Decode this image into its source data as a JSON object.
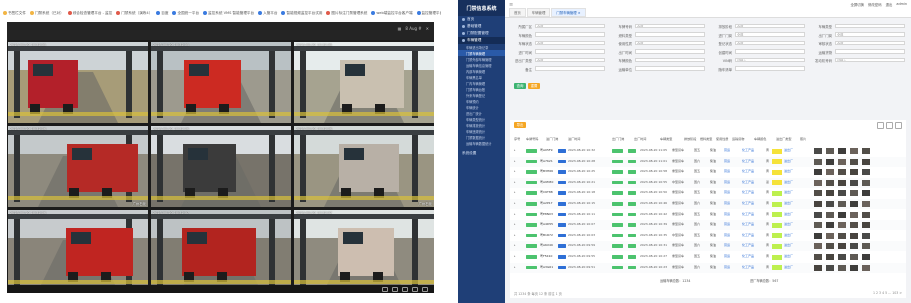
{
  "left": {
    "bookmarks": [
      {
        "label": "书签栏文件",
        "color": "#f2b544"
      },
      {
        "label": "门禁系统（已对）",
        "color": "#f2b544"
      },
      {
        "label": "综合检查管理平台 - 监控",
        "color": "#e05a4a"
      },
      {
        "label": "门禁系统（演练4）",
        "color": "#e05a4a"
      },
      {
        "label": "百度",
        "color": "#3a7be0"
      },
      {
        "label": "全国统一平台",
        "color": "#3a7be0"
      },
      {
        "label": "监控系统 VMS 智能管理平台",
        "color": "#3a7be0"
      },
      {
        "label": "入管平台",
        "color": "#3a7be0"
      },
      {
        "label": "智能视频监控平台试用",
        "color": "#3a7be0"
      },
      {
        "label": "图片标注门禁管理系统",
        "color": "#e05a4a"
      },
      {
        "label": "web端监控平台客户端",
        "color": "#3a7be0"
      },
      {
        "label": "监控管理平台",
        "color": "#3a7be0"
      }
    ],
    "toolbar_text": "8 Aug #",
    "bottom_text": "",
    "cams": [
      {
        "ts": "2023-08-20 10:32:05",
        "label": ""
      },
      {
        "ts": "2023-08-20 10:32:05",
        "label": ""
      },
      {
        "ts": "2023-08-20 10:32:05",
        "label": ""
      },
      {
        "ts": "2023-08-20 10:32:06",
        "label": "广州石化"
      },
      {
        "ts": "2023-08-20 10:32:06",
        "label": ""
      },
      {
        "ts": "2023-08-20 10:32:06",
        "label": "广州石化"
      },
      {
        "ts": "2023-08-20 10:32:06",
        "label": ""
      },
      {
        "ts": "2023-08-20 10:32:07",
        "label": "环保门禁系统-高清"
      },
      {
        "ts": "2023-08-20 10:32:07",
        "label": "进场道路-监控"
      }
    ]
  },
  "right": {
    "logo": "门禁信息系统",
    "header_right": [
      "全屏切换",
      "修改密码",
      "退出"
    ],
    "user": "admin",
    "tabs": [
      "首页",
      "车辆管理",
      "门禁车辆管理 ×"
    ],
    "menu": [
      {
        "label": "首页",
        "active": false
      },
      {
        "label": "基础管理",
        "active": false
      },
      {
        "label": "门禁配置管理",
        "active": false
      },
      {
        "label": "车辆管理",
        "active": true
      }
    ],
    "submenu": [
      "车辆进出场记录",
      "门禁车辆管理",
      "门禁外部车辆管理",
      "运输车辆信息管理",
      "内部车辆管理",
      "车辆黑名单",
      "厂内车辆管理",
      "门禁车辆台账",
      "外来车辆登记",
      "车辆预约",
      "车辆统计",
      "进出厂统计",
      "车辆类型统计",
      "车辆排放统计",
      "车辆违规统计",
      "门禁数据统计",
      "运输车辆数据统计"
    ],
    "menu_bottom": "系统设置",
    "filters": [
      {
        "label": "所属厂区",
        "value": "全部"
      },
      {
        "label": "车牌号码",
        "value": "全部"
      },
      {
        "label": "排放阶段",
        "value": "全部"
      },
      {
        "label": "车辆类型",
        "value": ""
      },
      {
        "label": "车辆颜色",
        "value": ""
      },
      {
        "label": "燃料类型",
        "value": ""
      },
      {
        "label": "进厂门岗",
        "value": "全部"
      },
      {
        "label": "出厂门岗",
        "value": "全部"
      },
      {
        "label": "车辆状态",
        "value": "全部"
      },
      {
        "label": "使用性质",
        "value": "全部"
      },
      {
        "label": "登记状态",
        "value": "全部"
      },
      {
        "label": "审核状态",
        "value": "全部"
      },
      {
        "label": "进厂时间",
        "value": ""
      },
      {
        "label": "出厂时间",
        "value": ""
      },
      {
        "label": "创建时间",
        "value": ""
      },
      {
        "label": "运输货物",
        "value": ""
      },
      {
        "label": "进出厂类型",
        "value": "全部"
      },
      {
        "label": "车牌颜色",
        "value": ""
      },
      {
        "label": "VIN码",
        "value": "请输入"
      },
      {
        "label": "发动机号码",
        "value": "请输入"
      },
      {
        "label": "备注",
        "value": ""
      },
      {
        "label": "运输单位",
        "value": ""
      },
      {
        "label": "随车清单",
        "value": ""
      }
    ],
    "btn_search": "查询",
    "btn_reset": "重置",
    "btn_export": "导出",
    "columns": [
      "序号",
      "车牌号码",
      "进厂门岗",
      "进厂时间",
      "出厂门岗",
      "出厂时间",
      "车辆类型",
      "排放阶段",
      "燃料类型",
      "使用性质",
      "运输货物",
      "车辆颜色",
      "进出厂类型",
      "照片"
    ],
    "rows": [
      {
        "plate": "粤A05F9",
        "tm1": "2023-08-20 10:32",
        "tm2": "2023-08-20 11:05",
        "type": "重型货车",
        "em": "国五",
        "fuel": "柴油",
        "col": "黄"
      },
      {
        "plate": "粤A7K21",
        "tm1": "2023-08-20 10:28",
        "tm2": "2023-08-20 11:01",
        "type": "重型货车",
        "em": "国六",
        "fuel": "柴油",
        "col": "黄"
      },
      {
        "plate": "粤B3H66",
        "tm1": "2023-08-20 10:25",
        "tm2": "2023-08-20 10:58",
        "type": "重型货车",
        "em": "国五",
        "fuel": "柴油",
        "col": "黄"
      },
      {
        "plate": "粤A9M30",
        "tm1": "2023-08-20 10:21",
        "tm2": "2023-08-20 10:55",
        "type": "中型货车",
        "em": "国六",
        "fuel": "柴油",
        "col": "蓝"
      },
      {
        "plate": "粤C6T88",
        "tm1": "2023-08-20 10:18",
        "tm2": "2023-08-20 10:50",
        "type": "重型货车",
        "em": "国五",
        "fuel": "柴油",
        "col": "黄"
      },
      {
        "plate": "粤A2P17",
        "tm1": "2023-08-20 10:15",
        "tm2": "2023-08-20 10:46",
        "type": "重型货车",
        "em": "国六",
        "fuel": "柴油",
        "col": "黄"
      },
      {
        "plate": "粤E8N03",
        "tm1": "2023-08-20 10:11",
        "tm2": "2023-08-20 10:42",
        "type": "重型货车",
        "em": "国五",
        "fuel": "柴油",
        "col": "黄"
      },
      {
        "plate": "粤A4D55",
        "tm1": "2023-08-20 10:07",
        "tm2": "2023-08-20 10:39",
        "type": "重型货车",
        "em": "国六",
        "fuel": "柴油",
        "col": "黄"
      },
      {
        "plate": "粤B1R72",
        "tm1": "2023-08-20 10:03",
        "tm2": "2023-08-20 10:35",
        "type": "中型货车",
        "em": "国五",
        "fuel": "柴油",
        "col": "黄"
      },
      {
        "plate": "粤A6X49",
        "tm1": "2023-08-20 09:59",
        "tm2": "2023-08-20 10:31",
        "type": "重型货车",
        "em": "国六",
        "fuel": "柴油",
        "col": "黄"
      },
      {
        "plate": "粤F5K10",
        "tm1": "2023-08-20 09:55",
        "tm2": "2023-08-20 10:27",
        "type": "重型货车",
        "em": "国五",
        "fuel": "柴油",
        "col": "黄"
      },
      {
        "plate": "粤A3G61",
        "tm1": "2023-08-20 09:51",
        "tm2": "2023-08-20 10:23",
        "type": "重型货车",
        "em": "国六",
        "fuel": "柴油",
        "col": "黄"
      }
    ],
    "row_tag_in": "已登记",
    "row_tag_gate": "1号门",
    "row_tag_out": "已出厂",
    "row_tag_gate2": "2号门",
    "row_use": "营运",
    "row_goods": "化工产品",
    "row_kind": "进出厂",
    "footer_left": "运输车辆总数：1234",
    "footer_mid": "进厂车辆总数：567",
    "pager_left": "共 1234 条  每页 12 条  前往 1 页",
    "pager_right": "1 2 3 4 5 ... 103 >"
  }
}
